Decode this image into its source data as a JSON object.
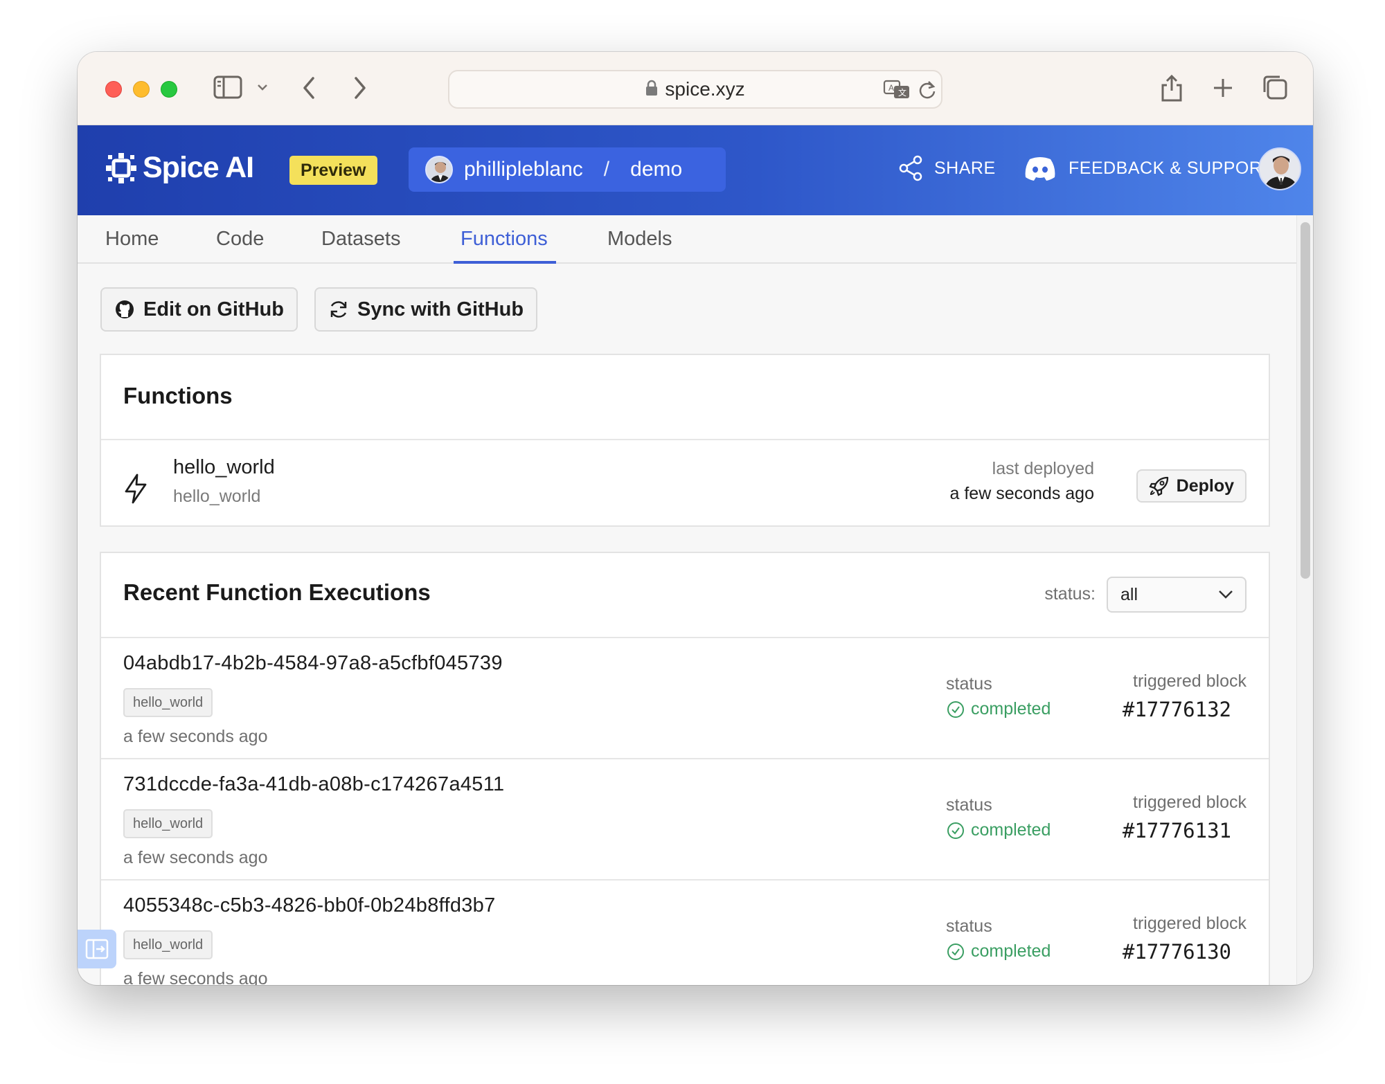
{
  "browser": {
    "url": "spice.xyz"
  },
  "header": {
    "logo_text": "Spice AI",
    "badge": "Preview",
    "breadcrumb": {
      "user": "phillipleblanc",
      "separator": "/",
      "repo": "demo"
    },
    "share_label": "SHARE",
    "feedback_label": "FEEDBACK & SUPPORT"
  },
  "tabs": [
    {
      "label": "Home"
    },
    {
      "label": "Code"
    },
    {
      "label": "Datasets"
    },
    {
      "label": "Functions",
      "active": true
    },
    {
      "label": "Models"
    }
  ],
  "actions": {
    "edit_github": "Edit on GitHub",
    "sync_github": "Sync with GitHub"
  },
  "functions_card": {
    "title": "Functions",
    "items": [
      {
        "name": "hello_world",
        "subtitle": "hello_world",
        "deployed_label": "last deployed",
        "deployed_value": "a few seconds ago",
        "deploy_label": "Deploy"
      }
    ]
  },
  "executions_card": {
    "title": "Recent Function Executions",
    "filter_label": "status:",
    "filter_value": "all",
    "rows": [
      {
        "id": "04abdb17-4b2b-4584-97a8-a5cfbf045739",
        "tag": "hello_world",
        "time": "a few seconds ago",
        "status_label": "status",
        "status": "completed",
        "block_label": "triggered block",
        "block": "#17776132"
      },
      {
        "id": "731dccde-fa3a-41db-a08b-c174267a4511",
        "tag": "hello_world",
        "time": "a few seconds ago",
        "status_label": "status",
        "status": "completed",
        "block_label": "triggered block",
        "block": "#17776131"
      },
      {
        "id": "4055348c-c5b3-4826-bb0f-0b24b8ffd3b7",
        "tag": "hello_world",
        "time": "a few seconds ago",
        "status_label": "status",
        "status": "completed",
        "block_label": "triggered block",
        "block": "#17776130"
      }
    ]
  },
  "colors": {
    "accent": "#3e5fd6",
    "header_start": "#1f3fad",
    "header_end": "#4f85ea",
    "badge": "#f4e05b",
    "status_completed": "#3a9e62"
  }
}
